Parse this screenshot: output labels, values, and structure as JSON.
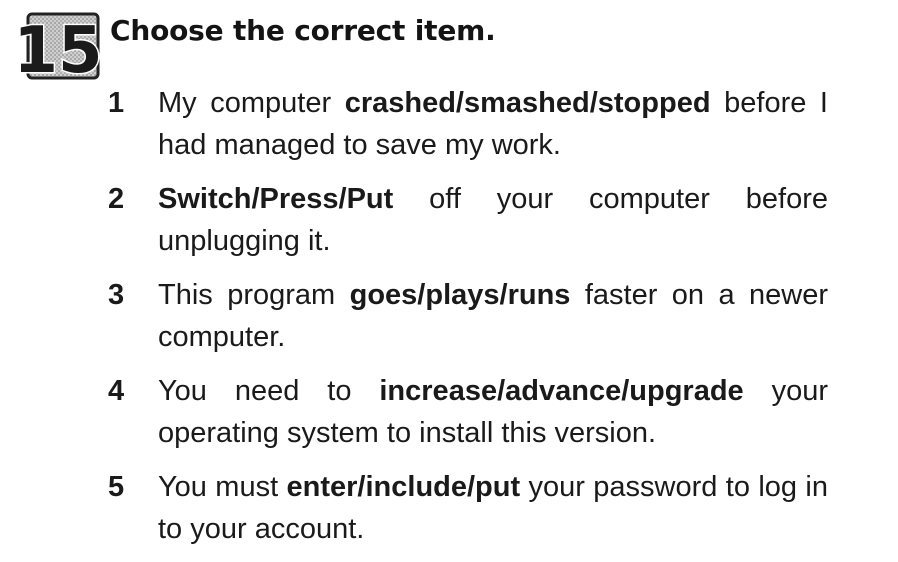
{
  "exercise": {
    "number": "15",
    "instruction": "Choose the correct item."
  },
  "items": [
    {
      "num": "1",
      "before": "My computer ",
      "options": "crashed/smashed/stopped",
      "after": " before I had managed to save my work."
    },
    {
      "num": "2",
      "before": "",
      "options": "Switch/Press/Put",
      "after": " off your computer before unplugging it."
    },
    {
      "num": "3",
      "before": "This program ",
      "options": "goes/plays/runs",
      "after": " faster on a newer computer."
    },
    {
      "num": "4",
      "before": "You need to ",
      "options": "increase/advance/upgrade",
      "after": " your operating system to install this version."
    },
    {
      "num": "5",
      "before": "You must ",
      "options": "enter/include/put",
      "after": " your password to log in to your account."
    }
  ]
}
